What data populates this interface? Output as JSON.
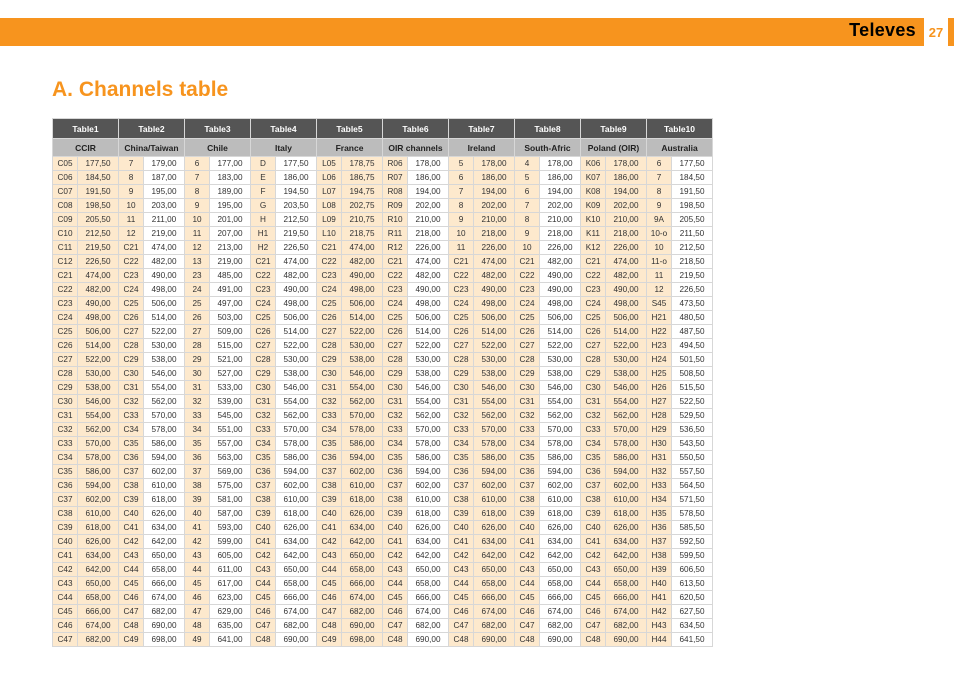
{
  "header": {
    "brand": "Televes",
    "page": "27"
  },
  "heading": "A. Channels table",
  "topHeaders": [
    "Table1",
    "Table2",
    "Table3",
    "Table4",
    "Table5",
    "Table6",
    "Table7",
    "Table8",
    "Table9",
    "Table10"
  ],
  "subHeaders": [
    "CCIR",
    "China/Taiwan",
    "Chile",
    "Italy",
    "France",
    "OIR channels",
    "Ireland",
    "South-Afric",
    "Poland (OIR)",
    "Australia"
  ],
  "tintCols": [
    0,
    4,
    6,
    8
  ],
  "chart_data": {
    "type": "table",
    "title": "A. Channels table",
    "columns": [
      "CCIR ch",
      "CCIR MHz",
      "China/Taiwan ch",
      "China/Taiwan MHz",
      "Chile ch",
      "Chile MHz",
      "Italy ch",
      "Italy MHz",
      "France ch",
      "France MHz",
      "OIR ch",
      "OIR MHz",
      "Ireland ch",
      "Ireland MHz",
      "South-Afric ch",
      "South-Afric MHz",
      "Poland(OIR) ch",
      "Poland(OIR) MHz",
      "Australia ch",
      "Australia MHz"
    ],
    "rows": [
      [
        "C05",
        "177,50",
        "7",
        "179,00",
        "6",
        "177,00",
        "D",
        "177,50",
        "L05",
        "178,75",
        "R06",
        "178,00",
        "5",
        "178,00",
        "4",
        "178,00",
        "K06",
        "178,00",
        "6",
        "177,50"
      ],
      [
        "C06",
        "184,50",
        "8",
        "187,00",
        "7",
        "183,00",
        "E",
        "186,00",
        "L06",
        "186,75",
        "R07",
        "186,00",
        "6",
        "186,00",
        "5",
        "186,00",
        "K07",
        "186,00",
        "7",
        "184,50"
      ],
      [
        "C07",
        "191,50",
        "9",
        "195,00",
        "8",
        "189,00",
        "F",
        "194,50",
        "L07",
        "194,75",
        "R08",
        "194,00",
        "7",
        "194,00",
        "6",
        "194,00",
        "K08",
        "194,00",
        "8",
        "191,50"
      ],
      [
        "C08",
        "198,50",
        "10",
        "203,00",
        "9",
        "195,00",
        "G",
        "203,50",
        "L08",
        "202,75",
        "R09",
        "202,00",
        "8",
        "202,00",
        "7",
        "202,00",
        "K09",
        "202,00",
        "9",
        "198,50"
      ],
      [
        "C09",
        "205,50",
        "11",
        "211,00",
        "10",
        "201,00",
        "H",
        "212,50",
        "L09",
        "210,75",
        "R10",
        "210,00",
        "9",
        "210,00",
        "8",
        "210,00",
        "K10",
        "210,00",
        "9A",
        "205,50"
      ],
      [
        "C10",
        "212,50",
        "12",
        "219,00",
        "11",
        "207,00",
        "H1",
        "219,50",
        "L10",
        "218,75",
        "R11",
        "218,00",
        "10",
        "218,00",
        "9",
        "218,00",
        "K11",
        "218,00",
        "10-o",
        "211,50"
      ],
      [
        "C11",
        "219,50",
        "C21",
        "474,00",
        "12",
        "213,00",
        "H2",
        "226,50",
        "C21",
        "474,00",
        "R12",
        "226,00",
        "11",
        "226,00",
        "10",
        "226,00",
        "K12",
        "226,00",
        "10",
        "212,50"
      ],
      [
        "C12",
        "226,50",
        "C22",
        "482,00",
        "13",
        "219,00",
        "C21",
        "474,00",
        "C22",
        "482,00",
        "C21",
        "474,00",
        "C21",
        "474,00",
        "C21",
        "482,00",
        "C21",
        "474,00",
        "11-o",
        "218,50"
      ],
      [
        "C21",
        "474,00",
        "C23",
        "490,00",
        "23",
        "485,00",
        "C22",
        "482,00",
        "C23",
        "490,00",
        "C22",
        "482,00",
        "C22",
        "482,00",
        "C22",
        "490,00",
        "C22",
        "482,00",
        "11",
        "219,50"
      ],
      [
        "C22",
        "482,00",
        "C24",
        "498,00",
        "24",
        "491,00",
        "C23",
        "490,00",
        "C24",
        "498,00",
        "C23",
        "490,00",
        "C23",
        "490,00",
        "C23",
        "490,00",
        "C23",
        "490,00",
        "12",
        "226,50"
      ],
      [
        "C23",
        "490,00",
        "C25",
        "506,00",
        "25",
        "497,00",
        "C24",
        "498,00",
        "C25",
        "506,00",
        "C24",
        "498,00",
        "C24",
        "498,00",
        "C24",
        "498,00",
        "C24",
        "498,00",
        "S45",
        "473,50"
      ],
      [
        "C24",
        "498,00",
        "C26",
        "514,00",
        "26",
        "503,00",
        "C25",
        "506,00",
        "C26",
        "514,00",
        "C25",
        "506,00",
        "C25",
        "506,00",
        "C25",
        "506,00",
        "C25",
        "506,00",
        "H21",
        "480,50"
      ],
      [
        "C25",
        "506,00",
        "C27",
        "522,00",
        "27",
        "509,00",
        "C26",
        "514,00",
        "C27",
        "522,00",
        "C26",
        "514,00",
        "C26",
        "514,00",
        "C26",
        "514,00",
        "C26",
        "514,00",
        "H22",
        "487,50"
      ],
      [
        "C26",
        "514,00",
        "C28",
        "530,00",
        "28",
        "515,00",
        "C27",
        "522,00",
        "C28",
        "530,00",
        "C27",
        "522,00",
        "C27",
        "522,00",
        "C27",
        "522,00",
        "C27",
        "522,00",
        "H23",
        "494,50"
      ],
      [
        "C27",
        "522,00",
        "C29",
        "538,00",
        "29",
        "521,00",
        "C28",
        "530,00",
        "C29",
        "538,00",
        "C28",
        "530,00",
        "C28",
        "530,00",
        "C28",
        "530,00",
        "C28",
        "530,00",
        "H24",
        "501,50"
      ],
      [
        "C28",
        "530,00",
        "C30",
        "546,00",
        "30",
        "527,00",
        "C29",
        "538,00",
        "C30",
        "546,00",
        "C29",
        "538,00",
        "C29",
        "538,00",
        "C29",
        "538,00",
        "C29",
        "538,00",
        "H25",
        "508,50"
      ],
      [
        "C29",
        "538,00",
        "C31",
        "554,00",
        "31",
        "533,00",
        "C30",
        "546,00",
        "C31",
        "554,00",
        "C30",
        "546,00",
        "C30",
        "546,00",
        "C30",
        "546,00",
        "C30",
        "546,00",
        "H26",
        "515,50"
      ],
      [
        "C30",
        "546,00",
        "C32",
        "562,00",
        "32",
        "539,00",
        "C31",
        "554,00",
        "C32",
        "562,00",
        "C31",
        "554,00",
        "C31",
        "554,00",
        "C31",
        "554,00",
        "C31",
        "554,00",
        "H27",
        "522,50"
      ],
      [
        "C31",
        "554,00",
        "C33",
        "570,00",
        "33",
        "545,00",
        "C32",
        "562,00",
        "C33",
        "570,00",
        "C32",
        "562,00",
        "C32",
        "562,00",
        "C32",
        "562,00",
        "C32",
        "562,00",
        "H28",
        "529,50"
      ],
      [
        "C32",
        "562,00",
        "C34",
        "578,00",
        "34",
        "551,00",
        "C33",
        "570,00",
        "C34",
        "578,00",
        "C33",
        "570,00",
        "C33",
        "570,00",
        "C33",
        "570,00",
        "C33",
        "570,00",
        "H29",
        "536,50"
      ],
      [
        "C33",
        "570,00",
        "C35",
        "586,00",
        "35",
        "557,00",
        "C34",
        "578,00",
        "C35",
        "586,00",
        "C34",
        "578,00",
        "C34",
        "578,00",
        "C34",
        "578,00",
        "C34",
        "578,00",
        "H30",
        "543,50"
      ],
      [
        "C34",
        "578,00",
        "C36",
        "594,00",
        "36",
        "563,00",
        "C35",
        "586,00",
        "C36",
        "594,00",
        "C35",
        "586,00",
        "C35",
        "586,00",
        "C35",
        "586,00",
        "C35",
        "586,00",
        "H31",
        "550,50"
      ],
      [
        "C35",
        "586,00",
        "C37",
        "602,00",
        "37",
        "569,00",
        "C36",
        "594,00",
        "C37",
        "602,00",
        "C36",
        "594,00",
        "C36",
        "594,00",
        "C36",
        "594,00",
        "C36",
        "594,00",
        "H32",
        "557,50"
      ],
      [
        "C36",
        "594,00",
        "C38",
        "610,00",
        "38",
        "575,00",
        "C37",
        "602,00",
        "C38",
        "610,00",
        "C37",
        "602,00",
        "C37",
        "602,00",
        "C37",
        "602,00",
        "C37",
        "602,00",
        "H33",
        "564,50"
      ],
      [
        "C37",
        "602,00",
        "C39",
        "618,00",
        "39",
        "581,00",
        "C38",
        "610,00",
        "C39",
        "618,00",
        "C38",
        "610,00",
        "C38",
        "610,00",
        "C38",
        "610,00",
        "C38",
        "610,00",
        "H34",
        "571,50"
      ],
      [
        "C38",
        "610,00",
        "C40",
        "626,00",
        "40",
        "587,00",
        "C39",
        "618,00",
        "C40",
        "626,00",
        "C39",
        "618,00",
        "C39",
        "618,00",
        "C39",
        "618,00",
        "C39",
        "618,00",
        "H35",
        "578,50"
      ],
      [
        "C39",
        "618,00",
        "C41",
        "634,00",
        "41",
        "593,00",
        "C40",
        "626,00",
        "C41",
        "634,00",
        "C40",
        "626,00",
        "C40",
        "626,00",
        "C40",
        "626,00",
        "C40",
        "626,00",
        "H36",
        "585,50"
      ],
      [
        "C40",
        "626,00",
        "C42",
        "642,00",
        "42",
        "599,00",
        "C41",
        "634,00",
        "C42",
        "642,00",
        "C41",
        "634,00",
        "C41",
        "634,00",
        "C41",
        "634,00",
        "C41",
        "634,00",
        "H37",
        "592,50"
      ],
      [
        "C41",
        "634,00",
        "C43",
        "650,00",
        "43",
        "605,00",
        "C42",
        "642,00",
        "C43",
        "650,00",
        "C42",
        "642,00",
        "C42",
        "642,00",
        "C42",
        "642,00",
        "C42",
        "642,00",
        "H38",
        "599,50"
      ],
      [
        "C42",
        "642,00",
        "C44",
        "658,00",
        "44",
        "611,00",
        "C43",
        "650,00",
        "C44",
        "658,00",
        "C43",
        "650,00",
        "C43",
        "650,00",
        "C43",
        "650,00",
        "C43",
        "650,00",
        "H39",
        "606,50"
      ],
      [
        "C43",
        "650,00",
        "C45",
        "666,00",
        "45",
        "617,00",
        "C44",
        "658,00",
        "C45",
        "666,00",
        "C44",
        "658,00",
        "C44",
        "658,00",
        "C44",
        "658,00",
        "C44",
        "658,00",
        "H40",
        "613,50"
      ],
      [
        "C44",
        "658,00",
        "C46",
        "674,00",
        "46",
        "623,00",
        "C45",
        "666,00",
        "C46",
        "674,00",
        "C45",
        "666,00",
        "C45",
        "666,00",
        "C45",
        "666,00",
        "C45",
        "666,00",
        "H41",
        "620,50"
      ],
      [
        "C45",
        "666,00",
        "C47",
        "682,00",
        "47",
        "629,00",
        "C46",
        "674,00",
        "C47",
        "682,00",
        "C46",
        "674,00",
        "C46",
        "674,00",
        "C46",
        "674,00",
        "C46",
        "674,00",
        "H42",
        "627,50"
      ],
      [
        "C46",
        "674,00",
        "C48",
        "690,00",
        "48",
        "635,00",
        "C47",
        "682,00",
        "C48",
        "690,00",
        "C47",
        "682,00",
        "C47",
        "682,00",
        "C47",
        "682,00",
        "C47",
        "682,00",
        "H43",
        "634,50"
      ],
      [
        "C47",
        "682,00",
        "C49",
        "698,00",
        "49",
        "641,00",
        "C48",
        "690,00",
        "C49",
        "698,00",
        "C48",
        "690,00",
        "C48",
        "690,00",
        "C48",
        "690,00",
        "C48",
        "690,00",
        "H44",
        "641,50"
      ]
    ]
  }
}
